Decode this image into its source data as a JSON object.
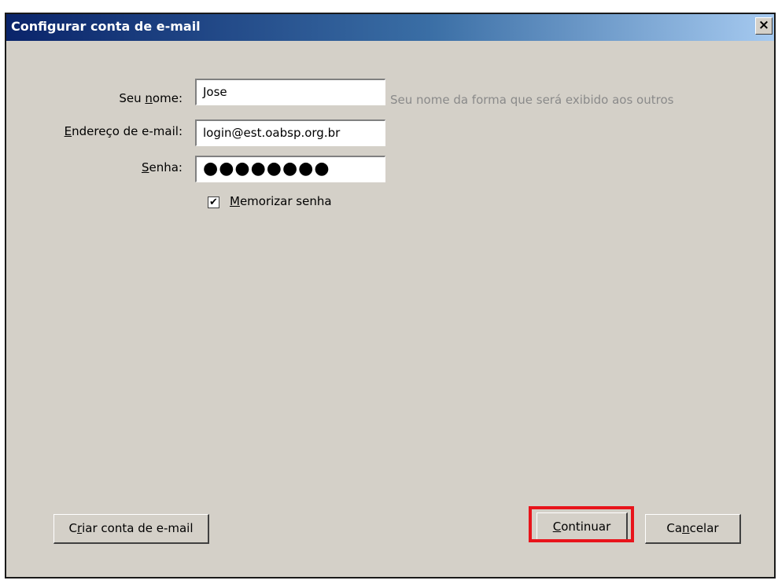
{
  "window": {
    "title": "Configurar conta de e-mail",
    "close_glyph": "×"
  },
  "form": {
    "name": {
      "label_before": "Seu ",
      "label_underline": "n",
      "label_after": "ome:",
      "value": "Jose",
      "hint": "Seu nome da forma que será exibido aos outros"
    },
    "email": {
      "label_before": "",
      "label_underline": "E",
      "label_after": "ndereço de e-mail:",
      "value": "login@est.oabsp.org.br"
    },
    "password": {
      "label_before": "",
      "label_underline": "S",
      "label_after": "enha:",
      "value": "●●●●●●●●"
    },
    "remember": {
      "checked_glyph": "✔",
      "label_underline": "M",
      "label_after": "emorizar senha"
    }
  },
  "buttons": {
    "create_account": {
      "before": "C",
      "underline": "r",
      "after": "iar conta de e-mail"
    },
    "continue": {
      "before": "",
      "underline": "C",
      "after": "ontinuar"
    },
    "cancel": {
      "before": "Ca",
      "underline": "n",
      "after": "celar"
    }
  },
  "colors": {
    "titlebar_start": "#0a246a",
    "titlebar_end": "#a6caf0",
    "highlight": "#e8141b",
    "dialog_bg": "#d4d0c8"
  }
}
